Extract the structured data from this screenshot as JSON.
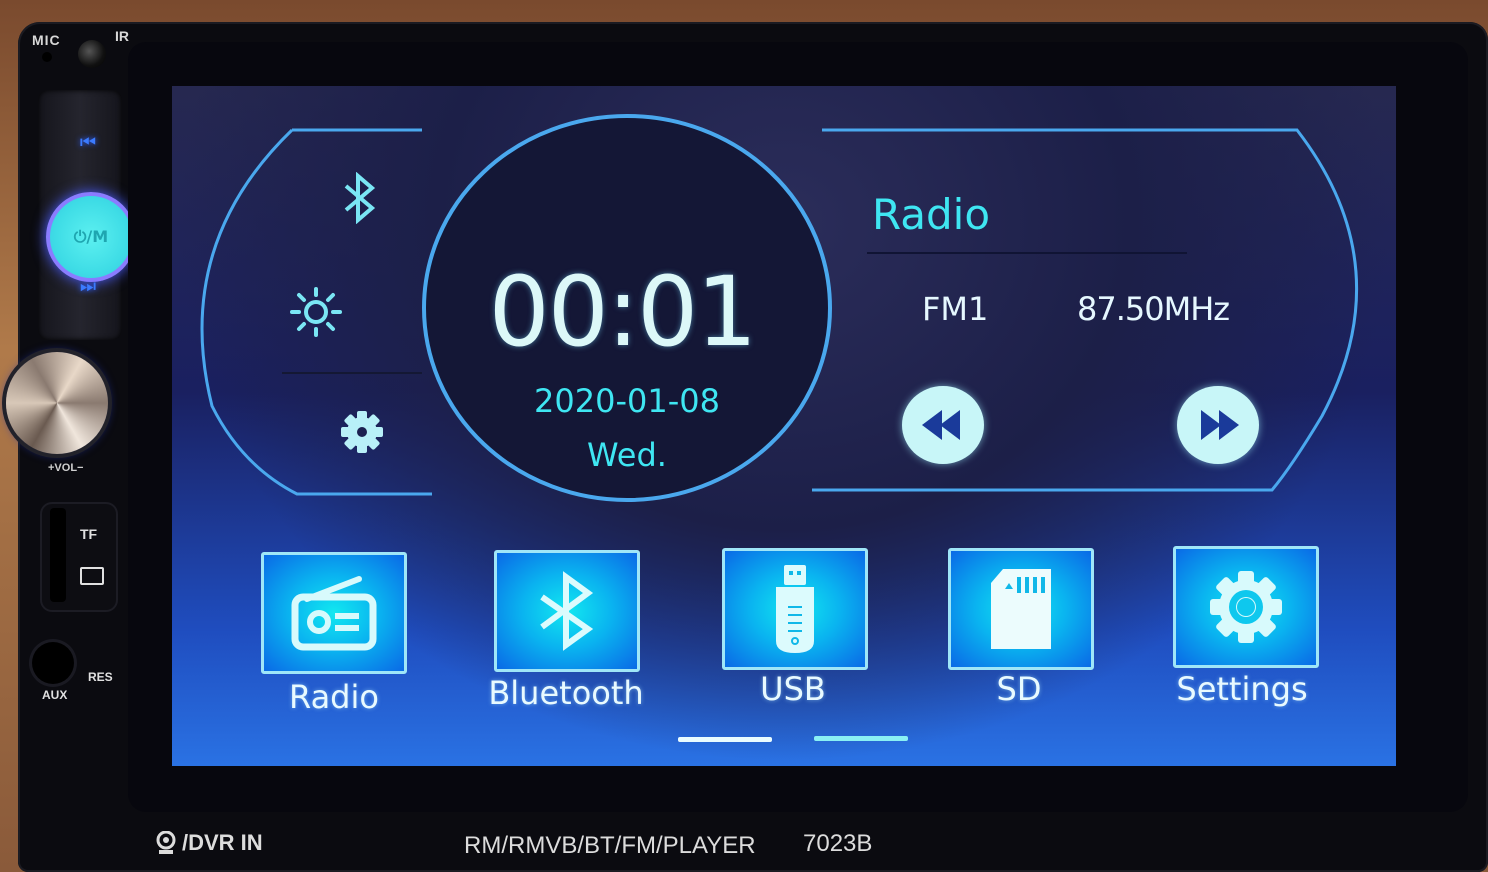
{
  "device": {
    "hardware_labels": {
      "mic": "MIC",
      "ir": "IR",
      "power_mode": "⏻/M",
      "volume": "+VOL−",
      "tf": "TF",
      "aux": "AUX",
      "res": "RES"
    },
    "front_text": {
      "dvr_in": "/DVR IN",
      "formats": "RM/RMVB/BT/FM/PLAYER",
      "model": "7023B"
    }
  },
  "quick_controls": [
    {
      "name": "bluetooth-icon",
      "label": "Bluetooth"
    },
    {
      "name": "brightness-icon",
      "label": "Brightness"
    },
    {
      "name": "gear-icon",
      "label": "Settings"
    }
  ],
  "clock": {
    "time": "00:01",
    "date": "2020-01-08",
    "day": "Wed."
  },
  "radio_widget": {
    "title": "Radio",
    "band": "FM1",
    "frequency": "87.50MHz",
    "seek_back_icon": "rewind-icon",
    "seek_forward_icon": "fast-forward-icon"
  },
  "apps": [
    {
      "label": "Radio",
      "icon": "radio-icon"
    },
    {
      "label": "Bluetooth",
      "icon": "bluetooth-icon"
    },
    {
      "label": "USB",
      "icon": "usb-drive-icon"
    },
    {
      "label": "SD",
      "icon": "sd-card-icon"
    },
    {
      "label": "Settings",
      "icon": "gear-icon"
    }
  ],
  "pager": {
    "pages": 2,
    "active_page": 1
  },
  "colors": {
    "accent_cyan": "#3fe6f2",
    "frame_blue": "#4aa8ee",
    "tile_border": "#9fe6f8",
    "text_light": "#e6f8ff"
  }
}
